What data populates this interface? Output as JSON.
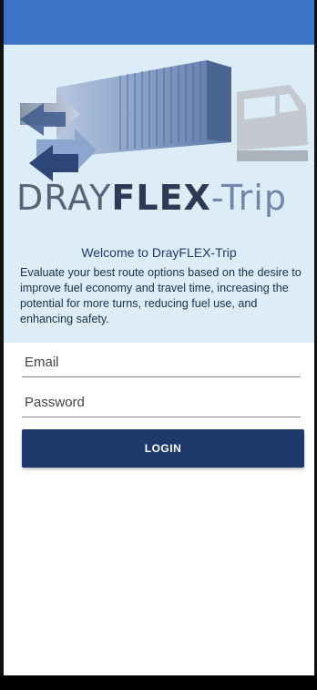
{
  "brand": {
    "wordmark_light": "DRAY",
    "wordmark_bold": "FLEX",
    "wordmark_suffix": "-Trip"
  },
  "welcome_title": "Welcome to DrayFLEX-Trip",
  "description": "Evaluate your best route options based on the desire to improve fuel economy and travel time, increasing the potential for more turns, reducing fuel use, and enhancing safety.",
  "form": {
    "email_placeholder": "Email",
    "password_placeholder": "Password",
    "login_label": "LOGIN"
  },
  "colors": {
    "app_bar": "#3b73c7",
    "hero_background": "#dcedf7",
    "button": "#1e3a6b"
  }
}
